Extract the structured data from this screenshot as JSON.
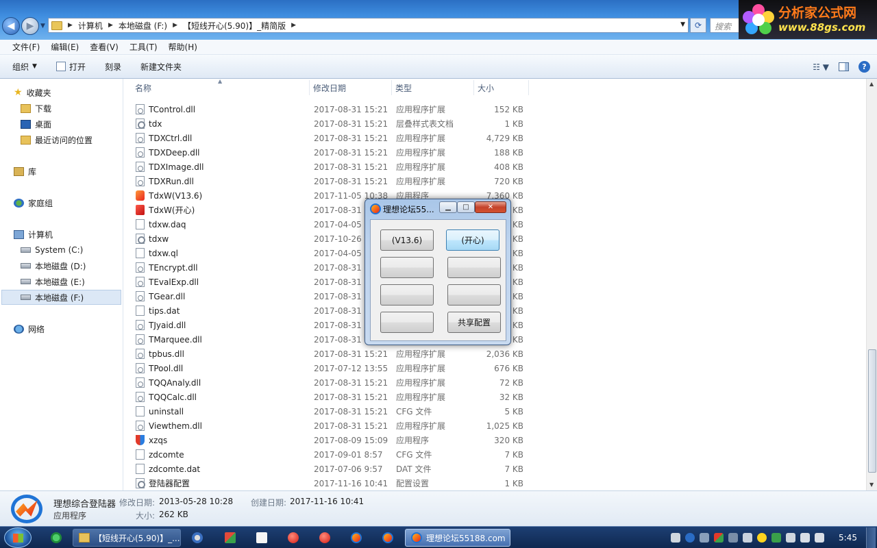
{
  "address": {
    "crumbs": [
      "计算机",
      "本地磁盘 (F:)",
      "【短线开心(5.90)】_精简版"
    ],
    "search_placeholder": "搜索",
    "logo_line1": "分析家公式网",
    "logo_line2": "www.88gs.com"
  },
  "menu": [
    "文件(F)",
    "编辑(E)",
    "查看(V)",
    "工具(T)",
    "帮助(H)"
  ],
  "toolbar": {
    "organize": "组织",
    "open": "打开",
    "burn": "刻录",
    "new_folder": "新建文件夹"
  },
  "nav": {
    "favorites": "收藏夹",
    "downloads": "下载",
    "desktop": "桌面",
    "recent": "最近访问的位置",
    "libraries": "库",
    "homegroup": "家庭组",
    "computer": "计算机",
    "drive_c": "System (C:)",
    "drive_d": "本地磁盘 (D:)",
    "drive_e": "本地磁盘 (E:)",
    "drive_f": "本地磁盘 (F:)",
    "network": "网络"
  },
  "columns": {
    "name": "名称",
    "date": "修改日期",
    "type": "类型",
    "size": "大小"
  },
  "files": [
    {
      "name": "TControl.dll",
      "date": "2017-08-31 15:21",
      "type": "应用程序扩展",
      "size": "152 KB",
      "icon": "dll"
    },
    {
      "name": "tdx",
      "date": "2017-08-31 15:21",
      "type": "层叠样式表文档",
      "size": "1 KB",
      "icon": "gear"
    },
    {
      "name": "TDXCtrl.dll",
      "date": "2017-08-31 15:21",
      "type": "应用程序扩展",
      "size": "4,729 KB",
      "icon": "dll"
    },
    {
      "name": "TDXDeep.dll",
      "date": "2017-08-31 15:21",
      "type": "应用程序扩展",
      "size": "188 KB",
      "icon": "dll"
    },
    {
      "name": "TDXImage.dll",
      "date": "2017-08-31 15:21",
      "type": "应用程序扩展",
      "size": "408 KB",
      "icon": "dll"
    },
    {
      "name": "TDXRun.dll",
      "date": "2017-08-31 15:21",
      "type": "应用程序扩展",
      "size": "720 KB",
      "icon": "dll"
    },
    {
      "name": "TdxW(V13.6)",
      "date": "2017-11-05 10:38",
      "type": "应用程序",
      "size": "7,360 KB",
      "icon": "exe1"
    },
    {
      "name": "TdxW(开心)",
      "date": "2017-08-31",
      "type": "",
      "size": "KB",
      "icon": "exe2"
    },
    {
      "name": "tdxw.daq",
      "date": "2017-04-05",
      "type": "",
      "size": "KB",
      "icon": "file"
    },
    {
      "name": "tdxw",
      "date": "2017-10-26",
      "type": "",
      "size": "KB",
      "icon": "gear"
    },
    {
      "name": "tdxw.ql",
      "date": "2017-04-05",
      "type": "",
      "size": "KB",
      "icon": "file"
    },
    {
      "name": "TEncrypt.dll",
      "date": "2017-08-31",
      "type": "",
      "size": "KB",
      "icon": "dll"
    },
    {
      "name": "TEvalExp.dll",
      "date": "2017-08-31",
      "type": "",
      "size": "KB",
      "icon": "dll"
    },
    {
      "name": "TGear.dll",
      "date": "2017-08-31",
      "type": "",
      "size": "KB",
      "icon": "dll"
    },
    {
      "name": "tips.dat",
      "date": "2017-08-31",
      "type": "",
      "size": "KB",
      "icon": "file"
    },
    {
      "name": "TJyaid.dll",
      "date": "2017-08-31",
      "type": "",
      "size": "KB",
      "icon": "dll"
    },
    {
      "name": "TMarquee.dll",
      "date": "2017-08-31",
      "type": "",
      "size": "KB",
      "icon": "dll"
    },
    {
      "name": "tpbus.dll",
      "date": "2017-08-31 15:21",
      "type": "应用程序扩展",
      "size": "2,036 KB",
      "icon": "dll"
    },
    {
      "name": "TPool.dll",
      "date": "2017-07-12 13:55",
      "type": "应用程序扩展",
      "size": "676 KB",
      "icon": "dll"
    },
    {
      "name": "TQQAnaly.dll",
      "date": "2017-08-31 15:21",
      "type": "应用程序扩展",
      "size": "72 KB",
      "icon": "dll"
    },
    {
      "name": "TQQCalc.dll",
      "date": "2017-08-31 15:21",
      "type": "应用程序扩展",
      "size": "32 KB",
      "icon": "dll"
    },
    {
      "name": "uninstall",
      "date": "2017-08-31 15:21",
      "type": "CFG 文件",
      "size": "5 KB",
      "icon": "file"
    },
    {
      "name": "Viewthem.dll",
      "date": "2017-08-31 15:21",
      "type": "应用程序扩展",
      "size": "1,025 KB",
      "icon": "dll"
    },
    {
      "name": "xzqs",
      "date": "2017-08-09 15:09",
      "type": "应用程序",
      "size": "320 KB",
      "icon": "shield"
    },
    {
      "name": "zdcomte",
      "date": "2017-09-01 8:57",
      "type": "CFG 文件",
      "size": "7 KB",
      "icon": "file"
    },
    {
      "name": "zdcomte.dat",
      "date": "2017-07-06 9:57",
      "type": "DAT 文件",
      "size": "7 KB",
      "icon": "file"
    },
    {
      "name": "登陆器配置",
      "date": "2017-11-16 10:41",
      "type": "配置设置",
      "size": "1 KB",
      "icon": "gear"
    }
  ],
  "details": {
    "name": "理想综合登陆器",
    "type": "应用程序",
    "modified_label": "修改日期:",
    "modified": "2013-05-28 10:28",
    "created_label": "创建日期:",
    "created": "2017-11-16 10:41",
    "size_label": "大小:",
    "size": "262 KB"
  },
  "dialog": {
    "title": "理想论坛55...",
    "btn1": "(V13.6)",
    "btn2": "(开心)",
    "btn3": "",
    "btn4": "",
    "btn5": "",
    "btn6": "",
    "btn7": "",
    "btn8": "共享配置"
  },
  "taskbar": {
    "explorer_task": "【短线开心(5.90)】_...",
    "dialog_task": "理想论坛55188.com",
    "clock": "5:45"
  }
}
